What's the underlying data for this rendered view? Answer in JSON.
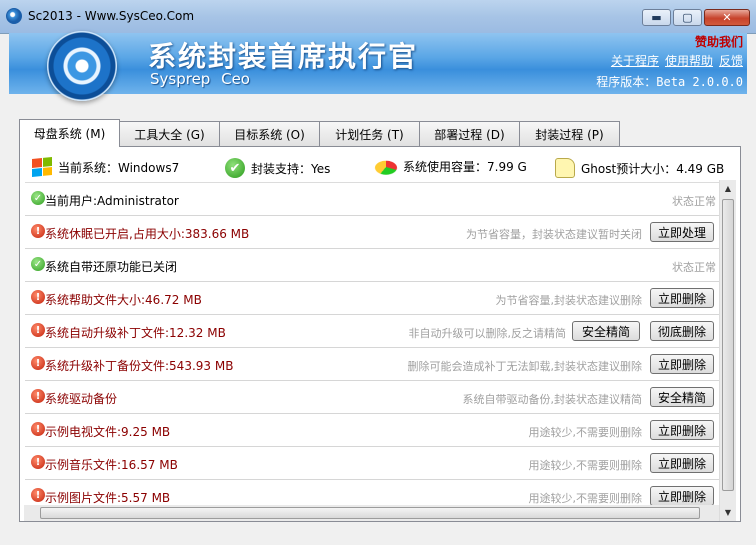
{
  "window": {
    "title": "Sc2013 - Www.SysCeo.Com"
  },
  "header": {
    "brand_cn": "系统封装首席执行官",
    "brand_en": "Sysprep Ceo",
    "sponsor": "赞助我们",
    "links": [
      "关于程序",
      "使用帮助",
      "反馈"
    ],
    "version_label": "程序版本：",
    "version_value": "Beta 2.0.0.0"
  },
  "tabs": [
    {
      "label": "母盘系统 (M)",
      "active": true
    },
    {
      "label": "工具大全 (G)"
    },
    {
      "label": "目标系统 (O)"
    },
    {
      "label": "计划任务 (T)"
    },
    {
      "label": "部署过程 (D)"
    },
    {
      "label": "封装过程 (P)"
    }
  ],
  "info": {
    "current_system": "当前系统：Windows7",
    "pack_support": "封装支持：Yes",
    "used_capacity": "系统使用容量：7.99 G",
    "ghost_size": "Ghost预计大小：4.49 GB"
  },
  "rows": [
    {
      "status": "ok",
      "label": "当前用户:Administrator",
      "hint": "状态正常",
      "buttons": []
    },
    {
      "status": "warn",
      "label": "系统休眠已开启,占用大小:383.66 MB",
      "hint": "为节省容量，封装状态建议暂时关闭",
      "buttons": [
        "立即处理"
      ]
    },
    {
      "status": "ok",
      "label": "系统自带还原功能已关闭",
      "hint": "状态正常",
      "buttons": []
    },
    {
      "status": "warn",
      "label": "系统帮助文件大小:46.72 MB",
      "hint": "为节省容量,封装状态建议删除",
      "buttons": [
        "立即删除"
      ]
    },
    {
      "status": "warn",
      "label": "系统自动升级补丁文件:12.32 MB",
      "hint": "非自动升级可以删除,反之请精简",
      "buttons": [
        "安全精简",
        "彻底删除"
      ]
    },
    {
      "status": "warn",
      "label": "系统升级补丁备份文件:543.93 MB",
      "hint": "删除可能会造成补丁无法卸载,封装状态建议删除",
      "buttons": [
        "立即删除"
      ]
    },
    {
      "status": "warn",
      "label": "系统驱动备份",
      "hint": "系统自带驱动备份,封装状态建议精简",
      "buttons": [
        "安全精简"
      ]
    },
    {
      "status": "warn",
      "label": "示例电视文件:9.25 MB",
      "hint": "用途较少,不需要则删除",
      "buttons": [
        "立即删除"
      ]
    },
    {
      "status": "warn",
      "label": "示例音乐文件:16.57 MB",
      "hint": "用途较少,不需要则删除",
      "buttons": [
        "立即删除"
      ]
    },
    {
      "status": "warn",
      "label": "示例图片文件:5.57 MB",
      "hint": "用途较少,不需要则删除",
      "buttons": [
        "立即删除"
      ]
    }
  ],
  "colors": {
    "accent": "#3a8fdc",
    "warn_text": "#8b0000",
    "sponsor": "#c00000"
  }
}
